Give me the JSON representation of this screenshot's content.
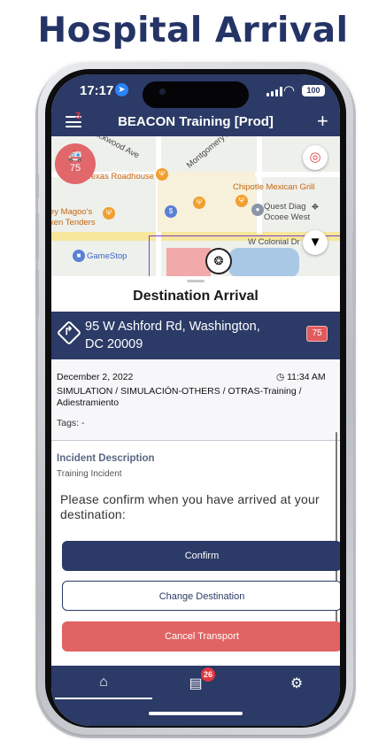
{
  "headline": "Hospital Arrival",
  "status_bar": {
    "time": "17:17",
    "battery": "100"
  },
  "header": {
    "title": "BEACON Training [Prod]",
    "menu_badge": "3",
    "add_icon": "+"
  },
  "map": {
    "unit_number": "75",
    "labels": {
      "road_blackwood": "Blackwood Ave",
      "road_montgomery": "Montgomery Ave",
      "texas_roadhouse": "Texas Roadhouse",
      "chipotle": "Chipotle Mexican Grill",
      "magoos": "ey Magoo's",
      "chicken": "ken Tenders",
      "quest1": "Quest Diag",
      "quest2": "Ocoee West",
      "colonial": "W Colonial Dr",
      "gamestop": "GameStop"
    }
  },
  "sheet": {
    "title": "Destination Arrival",
    "address_line1": "95 W Ashford Rd, Washington,",
    "address_line2": "DC 20009",
    "priority_badge": "75",
    "date": "December 2, 2022",
    "time": "11:34 AM",
    "incident_type": "SIMULATION / SIMULACIÓN-OTHERS / OTRAS-Training / Adiestramiento",
    "tags": "Tags: -",
    "description_heading": "Incident Description",
    "description_value": "Training Incident",
    "prompt": "Please confirm when you have arrived at your destination:",
    "confirm_label": "Confirm",
    "change_label": "Change Destination",
    "cancel_label": "Cancel Transport"
  },
  "tabbar": {
    "chat_badge": "26"
  },
  "colors": {
    "navy": "#2b3a66",
    "danger": "#e06463",
    "marker": "#e1676a"
  }
}
